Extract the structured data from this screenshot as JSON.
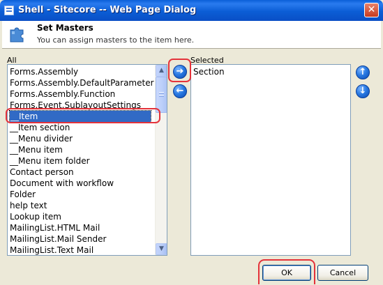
{
  "window": {
    "title": "Shell - Sitecore -- Web Page Dialog",
    "close_glyph": "✕"
  },
  "header": {
    "icon": "puzzle-icon",
    "title": "Set Masters",
    "subtitle": "You can assign masters to the item here."
  },
  "available": {
    "caption": "All",
    "items": [
      "Forms.Assembly",
      "Forms.Assembly.DefaultParameter",
      "Forms.Assembly.Function",
      "Forms.Event.SublayoutSettings",
      "__Item",
      "__Item section",
      "__Menu divider",
      "__Menu item",
      "__Menu item folder",
      "Contact person",
      "Document with workflow",
      "Folder",
      "help text",
      "Lookup item",
      "MailingList.HTML Mail",
      "MailingList.Mail Sender",
      "MailingList.Text Mail"
    ],
    "selected_item": "__Item"
  },
  "selected": {
    "caption": "Selected",
    "items": [
      "Section"
    ]
  },
  "controls": {
    "add_icon": "arrow-right-icon",
    "remove_icon": "arrow-left-icon",
    "move_up_icon": "arrow-up-icon",
    "move_down_icon": "arrow-down-icon",
    "add_glyph": "➔",
    "remove_glyph": "←",
    "up_glyph": "↑",
    "down_glyph": "↓"
  },
  "buttons": {
    "ok": "OK",
    "cancel": "Cancel"
  },
  "scrollbar": {
    "up_glyph": "▲",
    "down_glyph": "▼"
  },
  "colors": {
    "titlebar": "#0A5FD8",
    "selection": "#316AC5",
    "highlight": "#E4323A",
    "dialog_bg": "#ECE9D8"
  }
}
